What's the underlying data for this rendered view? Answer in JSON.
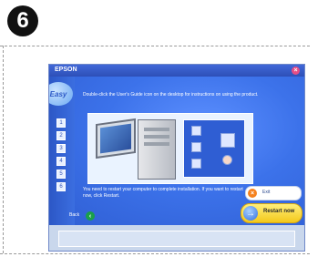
{
  "step": {
    "number": "6"
  },
  "window": {
    "title": "EPSON",
    "easy_label": "Easy",
    "step_numbers": [
      "1",
      "2",
      "3",
      "4",
      "5",
      "6"
    ],
    "instruction": "Double-click the User's Guide icon on the desktop for instructions on using the product.",
    "restart_message": "You need to restart your computer to complete installation. If you want to restart now, click Restart.",
    "buttons": {
      "exit": "Exit",
      "restart": "Restart now",
      "back": "Back"
    },
    "icons": {
      "close": "close-icon",
      "exit": "exit-icon",
      "restart": "arrow-right-icon",
      "back": "back-icon"
    }
  },
  "colors": {
    "titlebar": "#2d4fb7",
    "main_bg": "#3c72ea",
    "restart_button": "#f3c81b",
    "exit_icon": "#f5821f",
    "back_icon": "#1aa04a",
    "close_button": "#e54e86"
  }
}
